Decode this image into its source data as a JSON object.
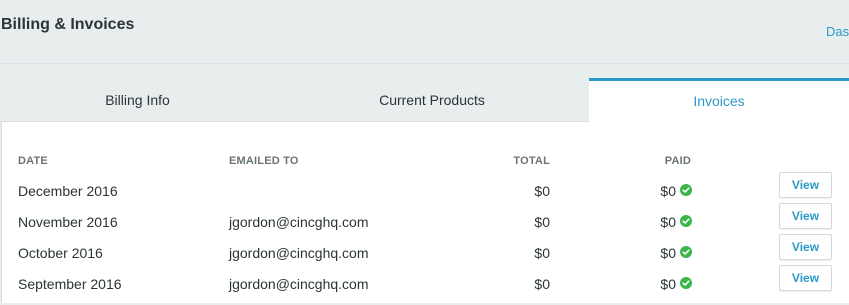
{
  "header": {
    "title": "Billing & Invoices",
    "breadcrumb_link": "Das"
  },
  "tabs": [
    {
      "label": "Billing Info",
      "active": false
    },
    {
      "label": "Current Products",
      "active": false
    },
    {
      "label": "Invoices",
      "active": true
    }
  ],
  "colors": {
    "accent": "#2c9ac9",
    "paid_check": "#39b54a",
    "background": "#e8edee"
  },
  "table": {
    "columns": [
      "DATE",
      "EMAILED TO",
      "TOTAL",
      "PAID"
    ],
    "rows": [
      {
        "date": "December 2016",
        "emailed_to": "",
        "total": "$0",
        "paid": "$0",
        "paid_icon": "check-circle-icon",
        "action": "View"
      },
      {
        "date": "November 2016",
        "emailed_to": "jgordon@cincghq.com",
        "total": "$0",
        "paid": "$0",
        "paid_icon": "check-circle-icon",
        "action": "View"
      },
      {
        "date": "October 2016",
        "emailed_to": "jgordon@cincghq.com",
        "total": "$0",
        "paid": "$0",
        "paid_icon": "check-circle-icon",
        "action": "View"
      },
      {
        "date": "September 2016",
        "emailed_to": "jgordon@cincghq.com",
        "total": "$0",
        "paid": "$0",
        "paid_icon": "check-circle-icon",
        "action": "View"
      }
    ]
  }
}
